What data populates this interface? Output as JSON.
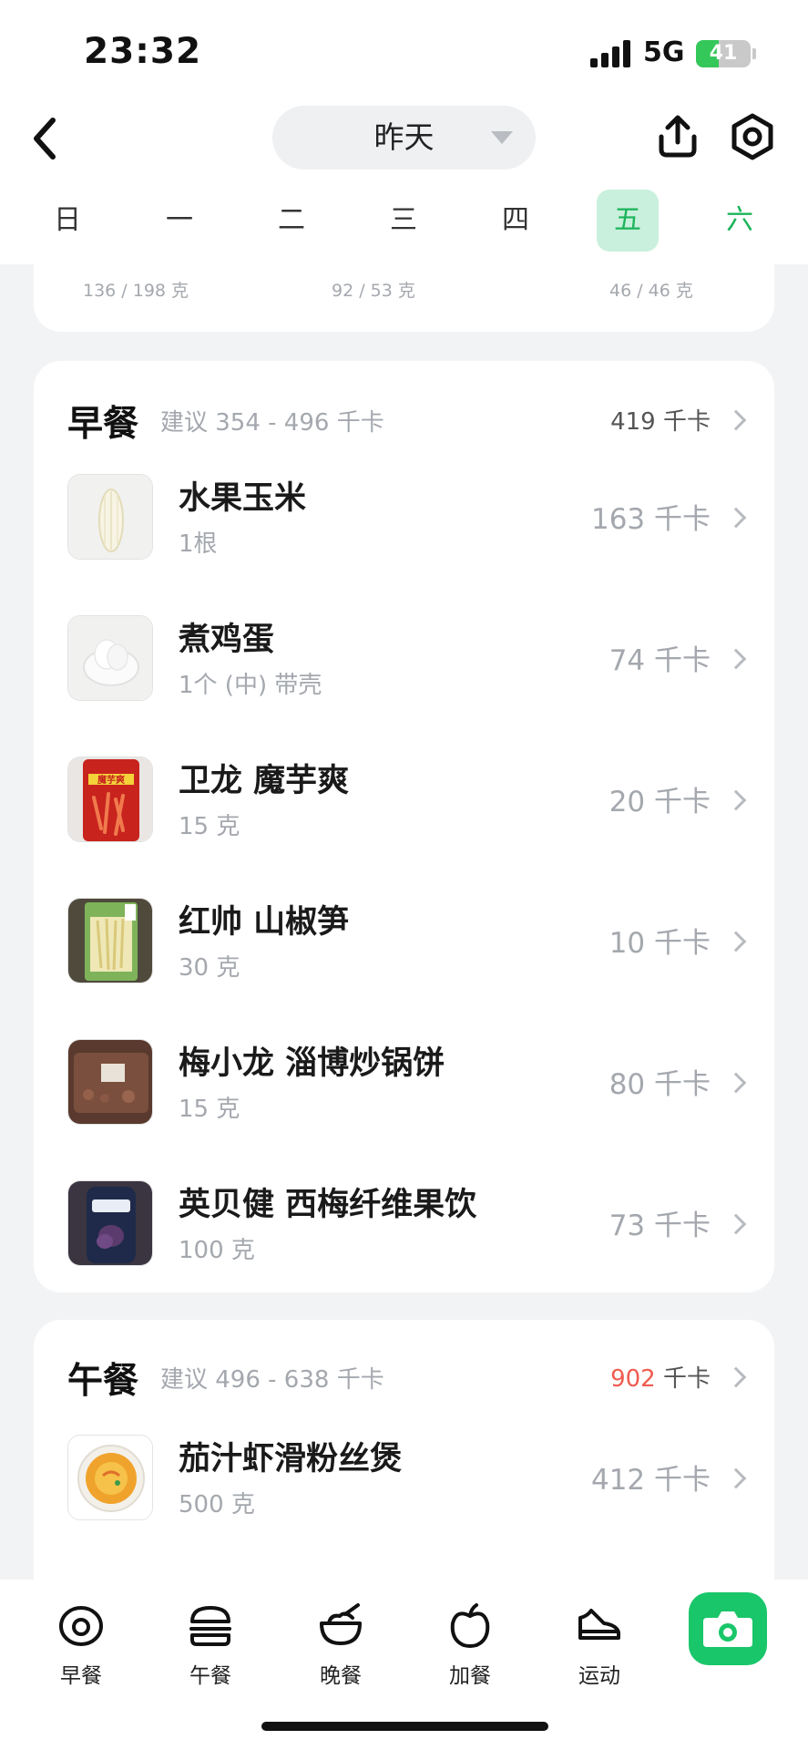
{
  "status_bar": {
    "time": "23:32",
    "network": "5G",
    "battery": "41",
    "battery_level": 0.41
  },
  "header": {
    "day": "昨天"
  },
  "week": {
    "days": [
      "日",
      "一",
      "二",
      "三",
      "四",
      "五",
      "六"
    ],
    "selected": "五"
  },
  "nutrients": [
    "136 / 198 克",
    "92 / 53 克",
    "46 / 46 克"
  ],
  "breakfast": {
    "title": "早餐",
    "suggest": "建议 354 - 496 千卡",
    "total_value": "419",
    "total_unit": "千卡",
    "items": [
      {
        "name": "水果玉米",
        "qty": "1根",
        "kcal": "163 千卡"
      },
      {
        "name": "煮鸡蛋",
        "qty": "1个 (中) 带壳",
        "kcal": "74 千卡"
      },
      {
        "name": "卫龙 魔芋爽",
        "qty": "15 克",
        "kcal": "20 千卡",
        "thumb_text": "魔芋爽"
      },
      {
        "name": "红帅 山椒笋",
        "qty": "30 克",
        "kcal": "10 千卡"
      },
      {
        "name": "梅小龙 淄博炒锅饼",
        "qty": "15 克",
        "kcal": "80 千卡"
      },
      {
        "name": "英贝健 西梅纤维果饮",
        "qty": "100 克",
        "kcal": "73 千卡"
      }
    ]
  },
  "lunch": {
    "title": "午餐",
    "suggest": "建议 496 - 638 千卡",
    "total_value": "902",
    "total_unit": "千卡",
    "items": [
      {
        "name": "茄汁虾滑粉丝煲",
        "qty": "500 克",
        "kcal": "412 千卡"
      }
    ]
  },
  "tabbar": {
    "tabs": [
      "早餐",
      "午餐",
      "晚餐",
      "加餐",
      "运动"
    ],
    "icons": [
      "breakfast-icon",
      "burger-icon",
      "bowl-icon",
      "apple-icon",
      "sneaker-icon",
      "camera-icon"
    ]
  },
  "colors": {
    "accent": "#1bb45a",
    "selected_day_bg": "#c9f0dc",
    "over_budget": "#ef5b50",
    "camera": "#19c66a"
  }
}
